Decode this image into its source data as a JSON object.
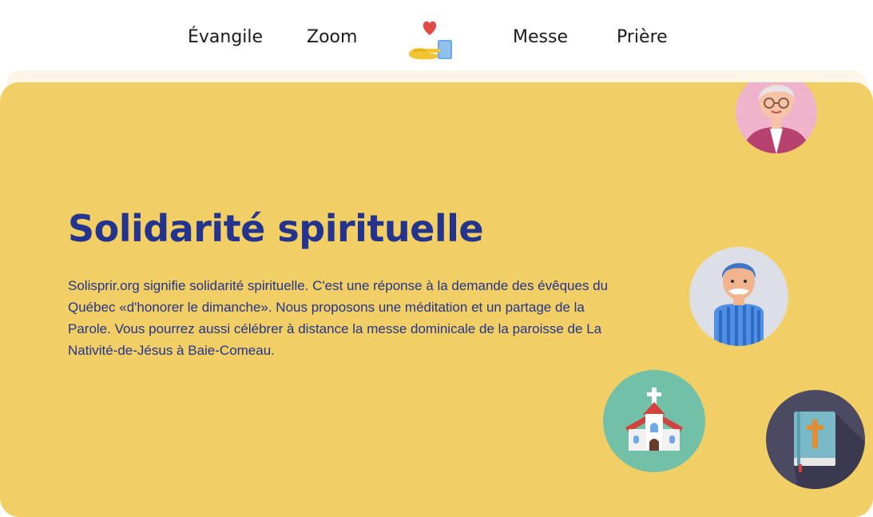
{
  "nav": {
    "items": [
      {
        "label": "Évangile"
      },
      {
        "label": "Zoom"
      },
      {
        "label": "Messe"
      },
      {
        "label": "Prière"
      }
    ],
    "logo_icon": "heart-in-hand-icon"
  },
  "hero": {
    "title": "Solidarité spirituelle",
    "text": "Solisprir.org signifie solidarité spirituelle. C'est une réponse à la demande des évêques du Québec «d'honorer le dimanche». Nous proposons une méditation et un partage de la Parole. Vous pourrez aussi célébrer à distance la messe dominicale de la paroisse de La Nativité-de-Jésus à Baie-Comeau.",
    "illustrations": [
      "woman-avatar-icon",
      "man-avatar-icon",
      "church-icon",
      "bible-icon"
    ]
  },
  "colors": {
    "hero_background": "#f2cf64",
    "title": "#23338e",
    "nav_text": "#1b1b1b"
  }
}
